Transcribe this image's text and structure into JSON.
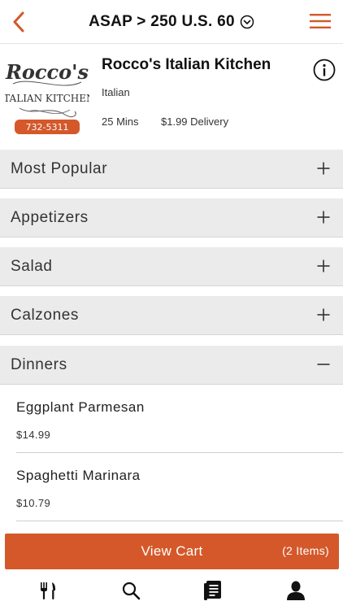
{
  "colors": {
    "accent": "#d4582a",
    "category_bg": "#ebebeb"
  },
  "header": {
    "back_icon": "chevron-left-icon",
    "title": "ASAP > 250 U.S. 60",
    "dropdown_icon": "circle-chevron-down-icon",
    "menu_icon": "hamburger-menu-icon"
  },
  "restaurant": {
    "name": "Rocco's Italian Kitchen",
    "cuisine": "Italian",
    "delivery_time": "25 Mins",
    "delivery_fee": "$1.99 Delivery",
    "info_icon": "info-icon",
    "logo": {
      "script": "Rocco's",
      "subtitle": "ITALIAN KITCHEN",
      "phone": "732-5311"
    }
  },
  "categories": [
    {
      "label": "Most Popular",
      "state": "collapsed"
    },
    {
      "label": "Appetizers",
      "state": "collapsed"
    },
    {
      "label": "Salad",
      "state": "collapsed"
    },
    {
      "label": "Calzones",
      "state": "collapsed"
    },
    {
      "label": "Dinners",
      "state": "expanded"
    }
  ],
  "dinners_items": [
    {
      "name": "Eggplant Parmesan",
      "price": "$14.99"
    },
    {
      "name": "Spaghetti Marinara",
      "price": "$10.79"
    }
  ],
  "cart": {
    "label": "View Cart",
    "count": "(2 Items)"
  },
  "tabbar": {
    "tabs": [
      {
        "icon": "fork-knife-icon"
      },
      {
        "icon": "search-icon"
      },
      {
        "icon": "order-list-icon"
      },
      {
        "icon": "account-icon"
      }
    ]
  }
}
